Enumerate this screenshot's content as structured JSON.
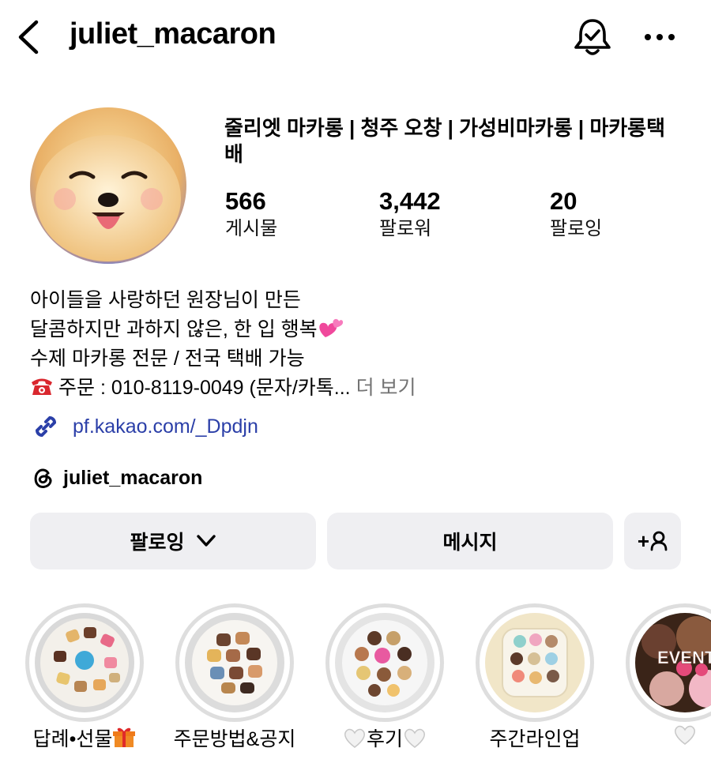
{
  "header": {
    "username": "juliet_macaron",
    "back_icon": "chevron-left-icon",
    "bell_icon": "bell-check-icon",
    "more_icon": "more-horizontal-icon"
  },
  "profile": {
    "display_name": "줄리엣 마카롱 | 청주 오창 | 가성비마카롱 | 마카롱택배",
    "stats": [
      {
        "count": "566",
        "label": "게시물"
      },
      {
        "count": "3,442",
        "label": "팔로워"
      },
      {
        "count": "20",
        "label": "팔로잉"
      }
    ],
    "bio": {
      "line1": "아이들을 사랑하던 원장님이 만든",
      "line2": "달콤하지만 과하지 않은, 한 입 행복",
      "line3": "수제 마카롱 전문 / 전국 택배 가능",
      "line4": "주문 : 010-8119-0049 (문자/카톡...",
      "more": "더 보기"
    },
    "link": "pf.kakao.com/_Dpdjn",
    "threads_handle": "juliet_macaron"
  },
  "actions": {
    "follow_label": "팔로잉",
    "message_label": "메시지",
    "adduser_label": "+"
  },
  "highlights": [
    {
      "label": "답례•선물"
    },
    {
      "label": "주문방법&공지"
    },
    {
      "label": "후기"
    },
    {
      "label": "주간라인업"
    },
    {
      "label": "",
      "image_text": "EVENT"
    }
  ],
  "colors": {
    "link": "#2b3fa8",
    "button_bg": "#efeff2",
    "ring": "#dedede",
    "muted": "#737373"
  }
}
